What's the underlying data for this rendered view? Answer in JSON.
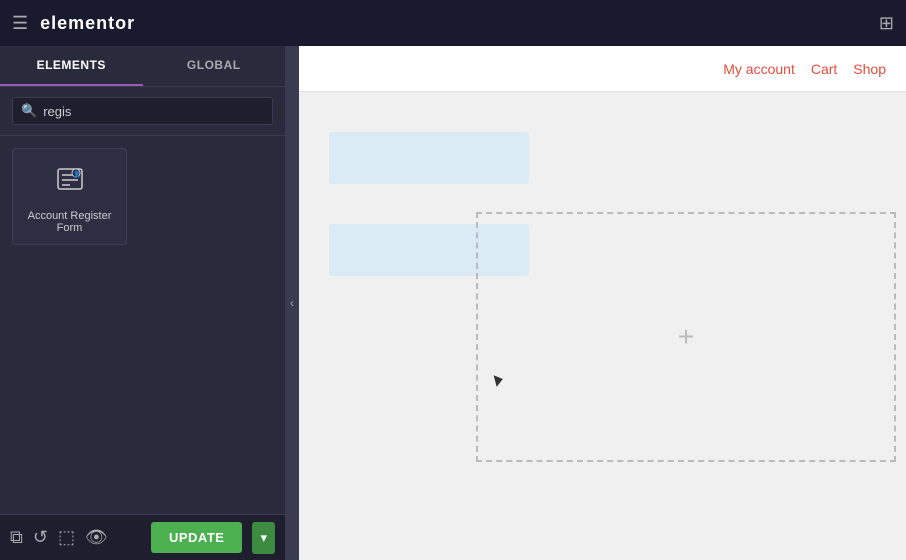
{
  "topBar": {
    "title": "elementor",
    "hamburgerIcon": "☰",
    "gridIcon": "⊞"
  },
  "sidebar": {
    "tabs": [
      {
        "id": "elements",
        "label": "ELEMENTS",
        "active": true
      },
      {
        "id": "global",
        "label": "GLOBAL",
        "active": false
      }
    ],
    "search": {
      "placeholder": "regis",
      "value": "regis",
      "icon": "🔍"
    },
    "widgets": [
      {
        "id": "account-register-form",
        "label": "Account Register Form",
        "icon": "📋",
        "pro": false
      }
    ]
  },
  "bottomToolbar": {
    "icons": [
      "layers",
      "history",
      "responsive",
      "eye"
    ],
    "updateButton": "UPDATE",
    "updateArrow": "▾"
  },
  "canvas": {
    "nav": [
      {
        "id": "my-account",
        "label": "My account"
      },
      {
        "id": "cart",
        "label": "Cart"
      },
      {
        "id": "shop",
        "label": "Shop"
      }
    ],
    "plusIcon": "+"
  },
  "collapseHandle": "‹"
}
